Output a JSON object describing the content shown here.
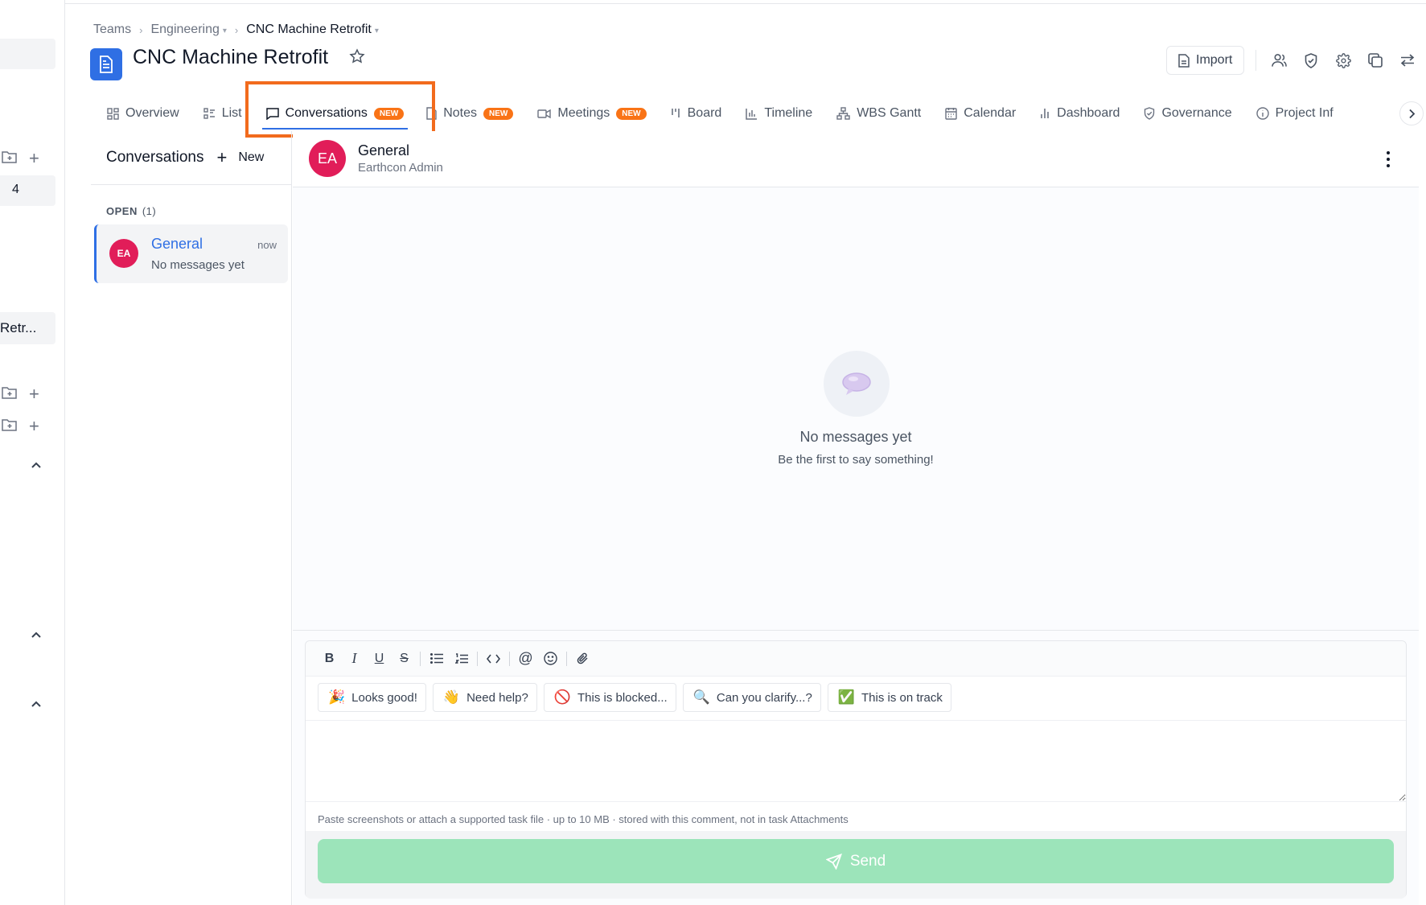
{
  "breadcrumb": {
    "items": [
      "Teams",
      "Engineering",
      "CNC Machine Retrofit"
    ]
  },
  "project": {
    "title": "CNC Machine Retrofit",
    "accent": "#2f6fe4"
  },
  "header": {
    "import_label": "Import"
  },
  "sidebar": {
    "count_label": "4",
    "truncated_label": "Retr..."
  },
  "tabs": [
    {
      "label": "Overview",
      "icon": "grid-icon",
      "badge": ""
    },
    {
      "label": "List",
      "icon": "list-icon",
      "badge": ""
    },
    {
      "label": "Conversations",
      "icon": "chat-icon",
      "badge": "NEW",
      "active": true
    },
    {
      "label": "Notes",
      "icon": "note-icon",
      "badge": "NEW"
    },
    {
      "label": "Meetings",
      "icon": "video-icon",
      "badge": "NEW"
    },
    {
      "label": "Board",
      "icon": "board-icon",
      "badge": ""
    },
    {
      "label": "Timeline",
      "icon": "timeline-icon",
      "badge": ""
    },
    {
      "label": "WBS Gantt",
      "icon": "hierarchy-icon",
      "badge": ""
    },
    {
      "label": "Calendar",
      "icon": "calendar-icon",
      "badge": ""
    },
    {
      "label": "Dashboard",
      "icon": "chart-icon",
      "badge": ""
    },
    {
      "label": "Governance",
      "icon": "shield-icon",
      "badge": ""
    },
    {
      "label": "Project Inf",
      "icon": "info-icon",
      "badge": ""
    }
  ],
  "conversations": {
    "title": "Conversations",
    "new_label": "New",
    "open_label": "OPEN",
    "open_count": "(1)",
    "items": [
      {
        "initials": "EA",
        "name": "General",
        "time": "now",
        "preview": "No messages yet"
      }
    ]
  },
  "chat": {
    "initials": "EA",
    "name": "General",
    "subtitle": "Earthcon Admin",
    "empty_title": "No messages yet",
    "empty_subtitle": "Be the first to say something!"
  },
  "composer": {
    "quick_replies": [
      {
        "emoji": "🎉",
        "label": "Looks good!"
      },
      {
        "emoji": "👋",
        "label": "Need help?"
      },
      {
        "emoji": "🚫",
        "label": "This is blocked..."
      },
      {
        "emoji": "🔍",
        "label": "Can you clarify...?"
      },
      {
        "emoji": "✅",
        "label": "This is on track"
      }
    ],
    "hint": "Paste screenshots or attach a supported task file · up to 10 MB · stored with this comment, not in task Attachments",
    "send_label": "Send",
    "send_color": "#9ce4ba"
  },
  "colors": {
    "avatar": "#e11d59",
    "badge": "#f97316",
    "highlight": "#f26b1d"
  }
}
